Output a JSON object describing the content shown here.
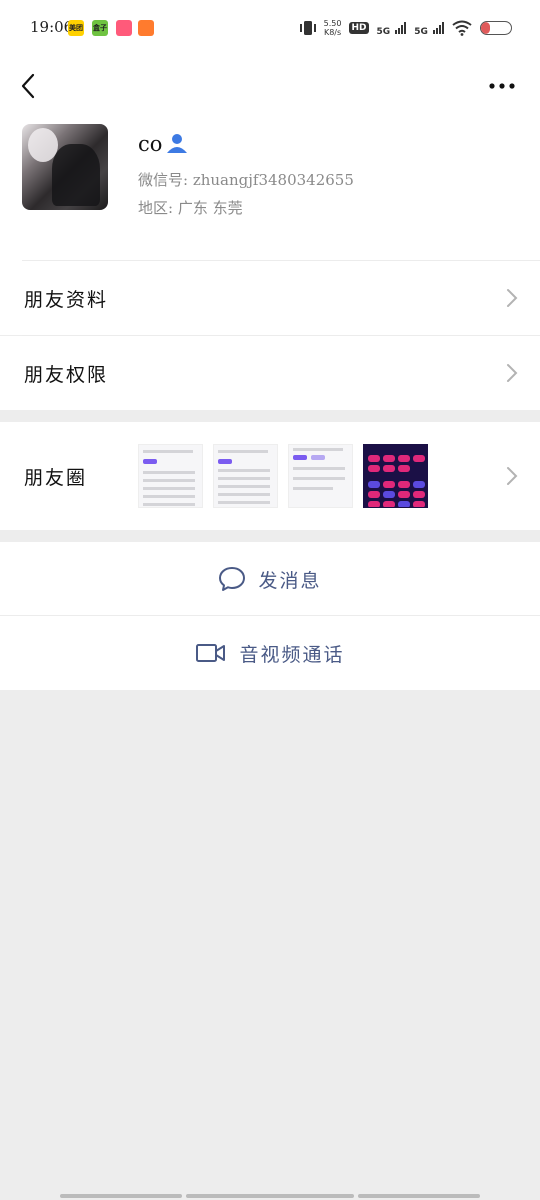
{
  "status_bar": {
    "time": "19:06",
    "apps": [
      "美团",
      "盒子",
      "",
      ""
    ],
    "net_speed_top": "5.50",
    "net_speed_bottom": "K8/s",
    "hd_label": "HD",
    "sim1": "5G",
    "sim2": "5G",
    "battery_level": 0.3
  },
  "header": {
    "back_icon": "chevron-left-icon",
    "more_icon": "more-dots-icon"
  },
  "profile": {
    "nickname": "co",
    "wechat_id_line": "微信号: zhuangjf3480342655",
    "region_line": "地区: 广东 东莞"
  },
  "menu": {
    "friend_profile": "朋友资料",
    "friend_permissions": "朋友权限",
    "moments": "朋友圈"
  },
  "actions": {
    "send_message": "发消息",
    "video_call": "音视频通话"
  },
  "colors": {
    "accent_blue": "#4a5a86",
    "person_icon": "#3d7ae3",
    "page_bg": "#ededed"
  }
}
